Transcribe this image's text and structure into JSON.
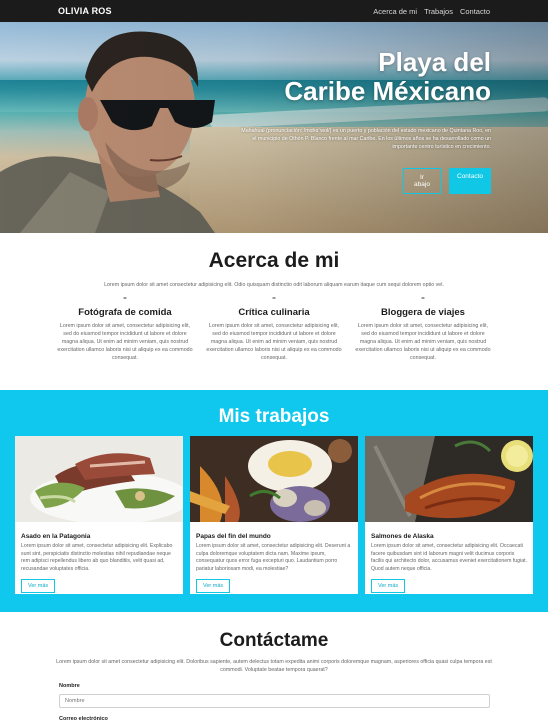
{
  "nav": {
    "brand": "OLIVIA ROS",
    "links": [
      "Acerca de mi",
      "Trabajos",
      "Contacto"
    ]
  },
  "hero": {
    "title_line1": "Playa del",
    "title_line2": "Caribe Méxicano",
    "description": "Mahahual (pronunciación: /mɑhɑˈwɑl/) es un puerto y población del estado mexicano de Quintana Roo, en el municipio de Othón P. Blanco frente al mar Caribe. En los últimos años se ha desarrollado como un importante centro turístico en crecimiento.",
    "buttons": [
      "Ir abajo",
      "Contacto"
    ]
  },
  "about": {
    "title": "Acerca de mi",
    "lead": "Lorem ipsum dolor sit amet consectetur adipisicing elit. Odio quisquam distinctio odit laborum aliquam earum itaque cum sequi dolorem optio vel.",
    "columns": [
      {
        "marker": "=",
        "title": "Fotógrafa de comida",
        "text": "Lorem ipsum dolor sit amet, consectetur adipisicing elit, sed do eiusmod tempor incididunt ut labore et dolore magna aliqua. Ut enim ad minim veniam, quis nostrud exercitation ullamco laboris nisi ut aliquip ex ea commodo consequat."
      },
      {
        "marker": "=",
        "title": "Crítica culinaria",
        "text": "Lorem ipsum dolor sit amet, consectetur adipisicing elit, sed do eiusmod tempor incididunt ut labore et dolore magna aliqua. Ut enim ad minim veniam, quis nostrud exercitation ullamco laboris nisi ut aliquip ex ea commodo consequat."
      },
      {
        "marker": "=",
        "title": "Bloggera de viajes",
        "text": "Lorem ipsum dolor sit amet, consectetur adipisicing elit, sed do eiusmod tempor incididunt ut labore et dolore magna aliqua. Ut enim ad minim veniam, quis nostrud exercitation ullamco laboris nisi ut aliquip ex ea commodo consequat."
      }
    ]
  },
  "works": {
    "title": "Mis trabajos",
    "cards": [
      {
        "title": "Asado en la Patagonia",
        "text": "Lorem ipsum dolor sit amet, consectetur adipisicing elit. Explicabo sunt sint, perspiciatis distinctio molestias nihil repudiandae neque rem adipisci repellendus libero ab quo blanditiis, velit quasi ad, recusandae voluptates officia.",
        "button": "Ver más"
      },
      {
        "title": "Papas del fin del mundo",
        "text": "Lorem ipsum dolor sit amet, consectetur adipisicing elit. Deserunt a culpa doloremque voluptatem dicta nam. Maxime ipsum, consequatur quos error fuga excepturi quo. Laudantium porro pariatur laboriosam modi, ea molestiae?",
        "button": "Ver más"
      },
      {
        "title": "Salmones de Alaska",
        "text": "Lorem ipsum dolor sit amet, consectetur adipisicing elit. Occaecati facere quibusdam sint id laborum magni velit ducimus corporis facilis qui architecto dolor, accusamus eveniet exercitationem fugiat. Quod autem neque officia.",
        "button": "Ver más"
      }
    ]
  },
  "contact": {
    "title": "Contáctame",
    "lead": "Lorem ipsum dolor sit amet consectetur adipisicing elit. Doloribus sapiente, autem delectus totam expedita animi corporis doloremque magnam, asperiores officia quasi culpa tempora est commodi. Voluptate beatae tempora quaerat?",
    "name_label": "Nombre",
    "name_placeholder": "Nombre",
    "email_label": "Correo electrónico"
  },
  "colors": {
    "accent": "#10c8ee",
    "navbar": "#1b1b1b"
  }
}
